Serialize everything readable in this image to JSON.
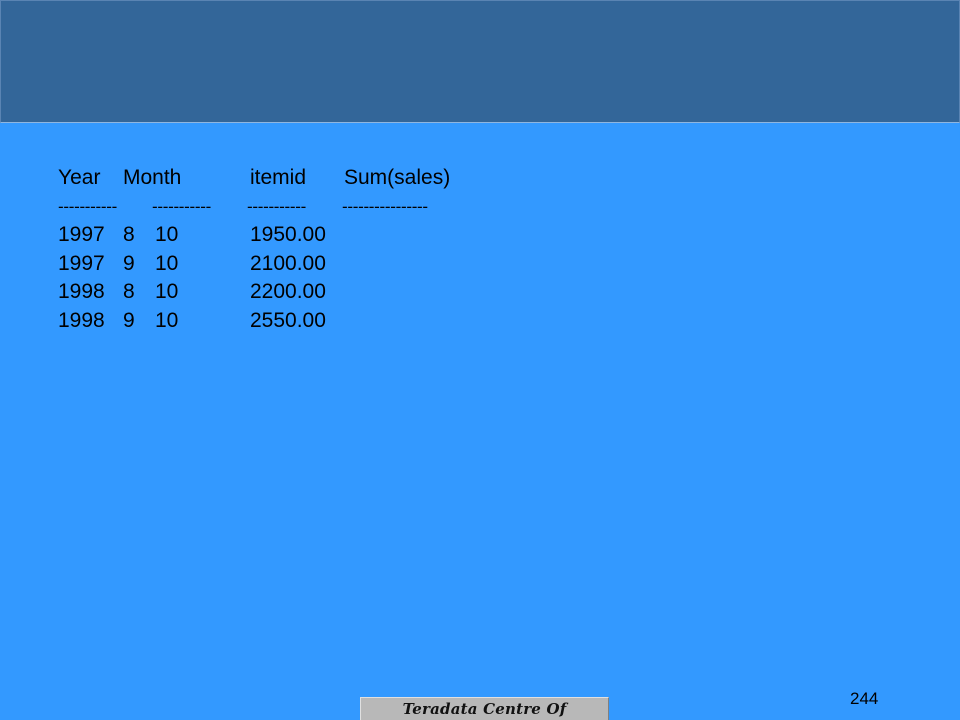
{
  "slide": {
    "page_number": "244",
    "footer_logo_text": "Teradata Centre Of Excellence"
  },
  "table": {
    "headers": [
      "Year",
      "Month",
      "itemid",
      "Sum(sales)"
    ],
    "separators": [
      "-----------",
      "-----------",
      "-----------",
      "----------------"
    ],
    "rows": [
      [
        "1997",
        "8",
        "10",
        "1950.00"
      ],
      [
        "1997",
        "9",
        "10",
        "2100.00"
      ],
      [
        "1998",
        "8",
        "10",
        "2200.00"
      ],
      [
        "1998",
        "9",
        "10",
        "2550.00"
      ]
    ]
  },
  "colors": {
    "background": "#3399ff",
    "header_band": "#336699",
    "footer_logo_bg": "#b8b8b8"
  }
}
